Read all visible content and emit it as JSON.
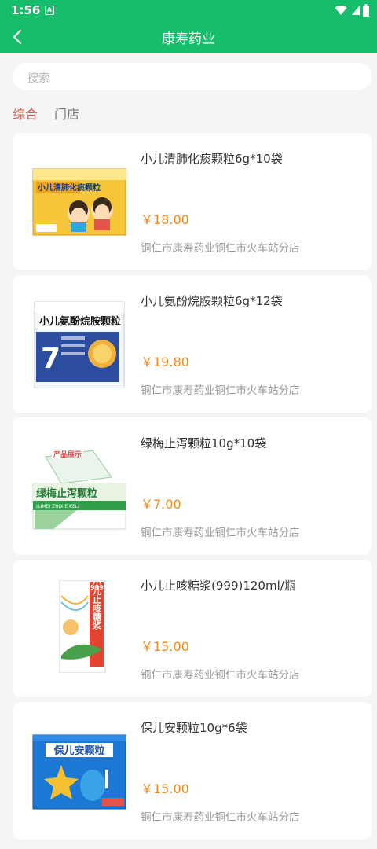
{
  "status_bar": {
    "time": "1:56",
    "notification_glyph": "A"
  },
  "header": {
    "back_icon": "chevron-left-icon",
    "title": "康寿药业"
  },
  "search": {
    "placeholder": "搜索"
  },
  "tabs": [
    {
      "label": "综合",
      "active": true
    },
    {
      "label": "门店",
      "active": false
    }
  ],
  "products": [
    {
      "name": "小儿清肺化痰颗粒6g*10袋",
      "price": "￥18.00",
      "store": "铜仁市康寿药业铜仁市火车站分店",
      "image_label": "小儿清肺化痰颗粒",
      "image_sub": "",
      "image_brand": ""
    },
    {
      "name": "小儿氨酚烷胺颗粒6g*12袋",
      "price": "￥19.80",
      "store": "铜仁市康寿药业铜仁市火车站分店",
      "image_label": "小儿氨酚烷胺颗粒",
      "image_sub": "7",
      "image_brand": ""
    },
    {
      "name": "绿梅止泻颗粒10g*10袋",
      "price": "￥7.00",
      "store": "铜仁市康寿药业铜仁市火车站分店",
      "image_label": "绿梅止泻颗粒",
      "image_sub": "LUMEI ZHIXIE KELI",
      "image_brand": "产品展示"
    },
    {
      "name": "小儿止咳糖浆(999)120ml/瓶",
      "price": "￥15.00",
      "store": "铜仁市康寿药业铜仁市火车站分店",
      "image_label": "小儿止咳糖浆",
      "image_sub": "",
      "image_brand": "999"
    },
    {
      "name": "保儿安颗粒10g*6袋",
      "price": "￥15.00",
      "store": "铜仁市康寿药业铜仁市火车站分店",
      "image_label": "保儿安颗粒",
      "image_sub": "",
      "image_brand": ""
    }
  ],
  "colors": {
    "primary": "#16bd6a",
    "price": "#f08a1c",
    "active_tab": "#e2544a",
    "background": "#f5f5f5"
  }
}
